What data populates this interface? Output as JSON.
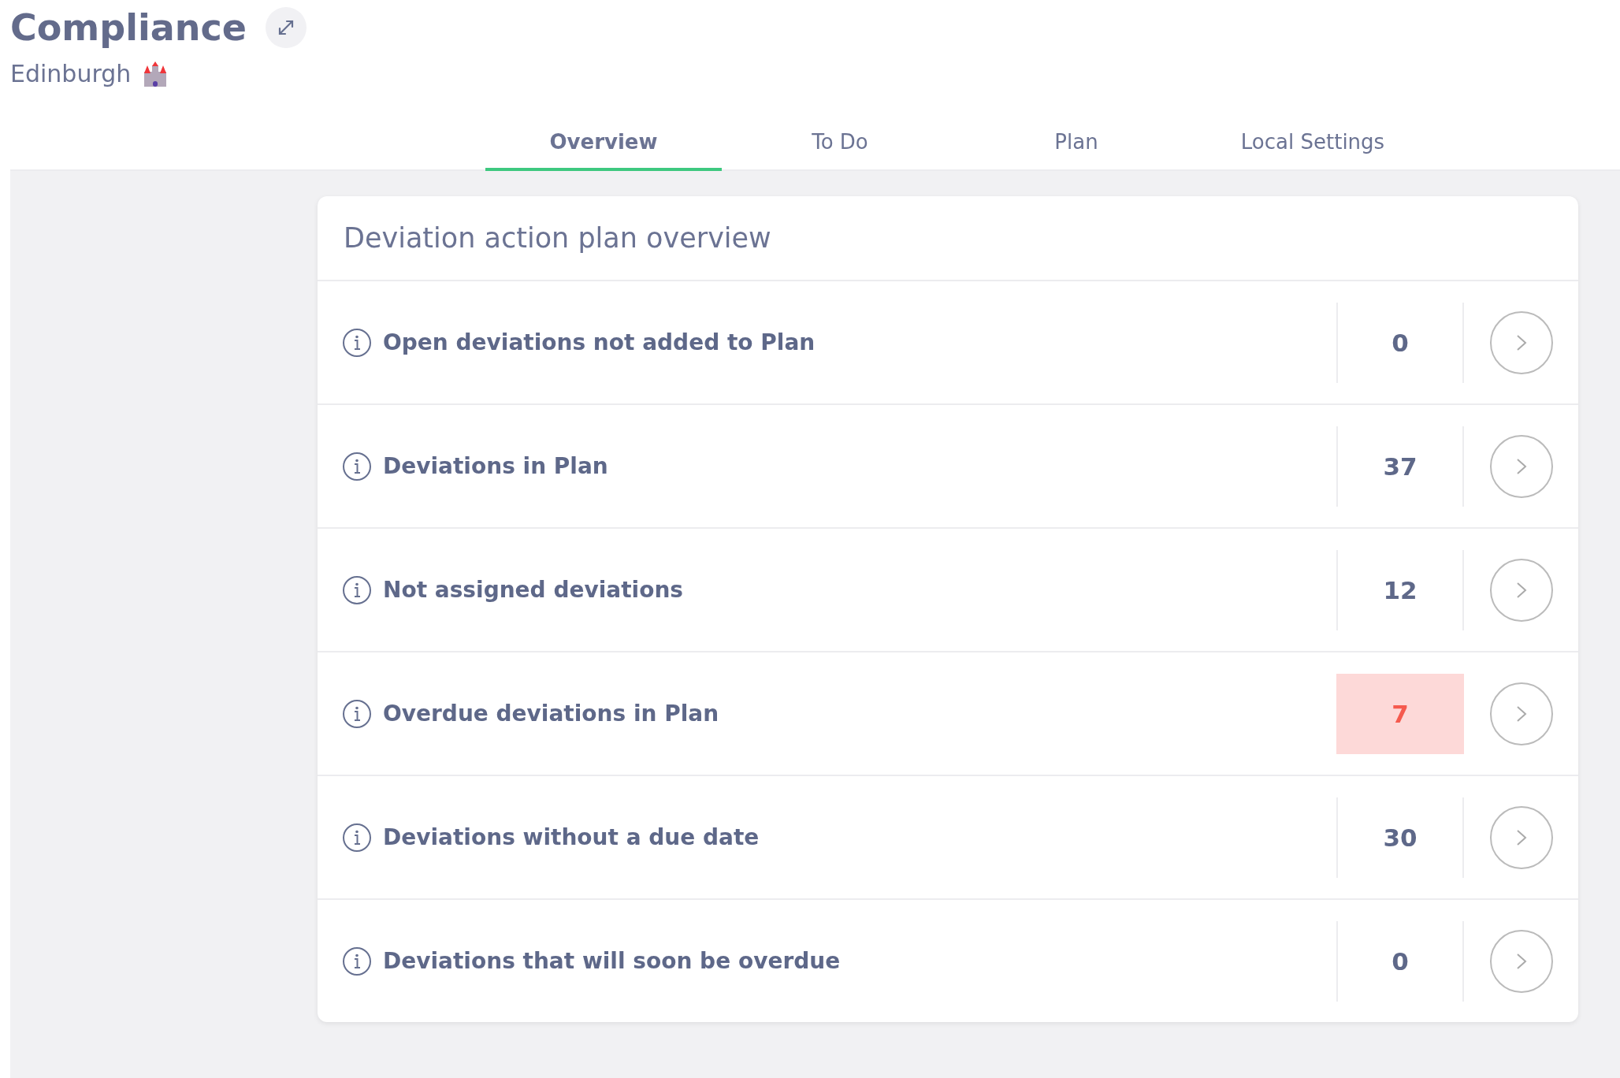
{
  "header": {
    "title": "Compliance",
    "location": "Edinburgh"
  },
  "tabs": [
    {
      "label": "Overview",
      "selected": true
    },
    {
      "label": "To Do",
      "selected": false
    },
    {
      "label": "Plan",
      "selected": false
    },
    {
      "label": "Local Settings",
      "selected": false
    }
  ],
  "card": {
    "title": "Deviation action plan overview",
    "rows": [
      {
        "label": "Open deviations not added to Plan",
        "count": "0",
        "alert": false
      },
      {
        "label": "Deviations in Plan",
        "count": "37",
        "alert": false
      },
      {
        "label": "Not assigned deviations",
        "count": "12",
        "alert": false
      },
      {
        "label": "Overdue deviations in Plan",
        "count": "7",
        "alert": true
      },
      {
        "label": "Deviations without a due date",
        "count": "30",
        "alert": false
      },
      {
        "label": "Deviations that will soon be overdue",
        "count": "0",
        "alert": false
      }
    ]
  }
}
